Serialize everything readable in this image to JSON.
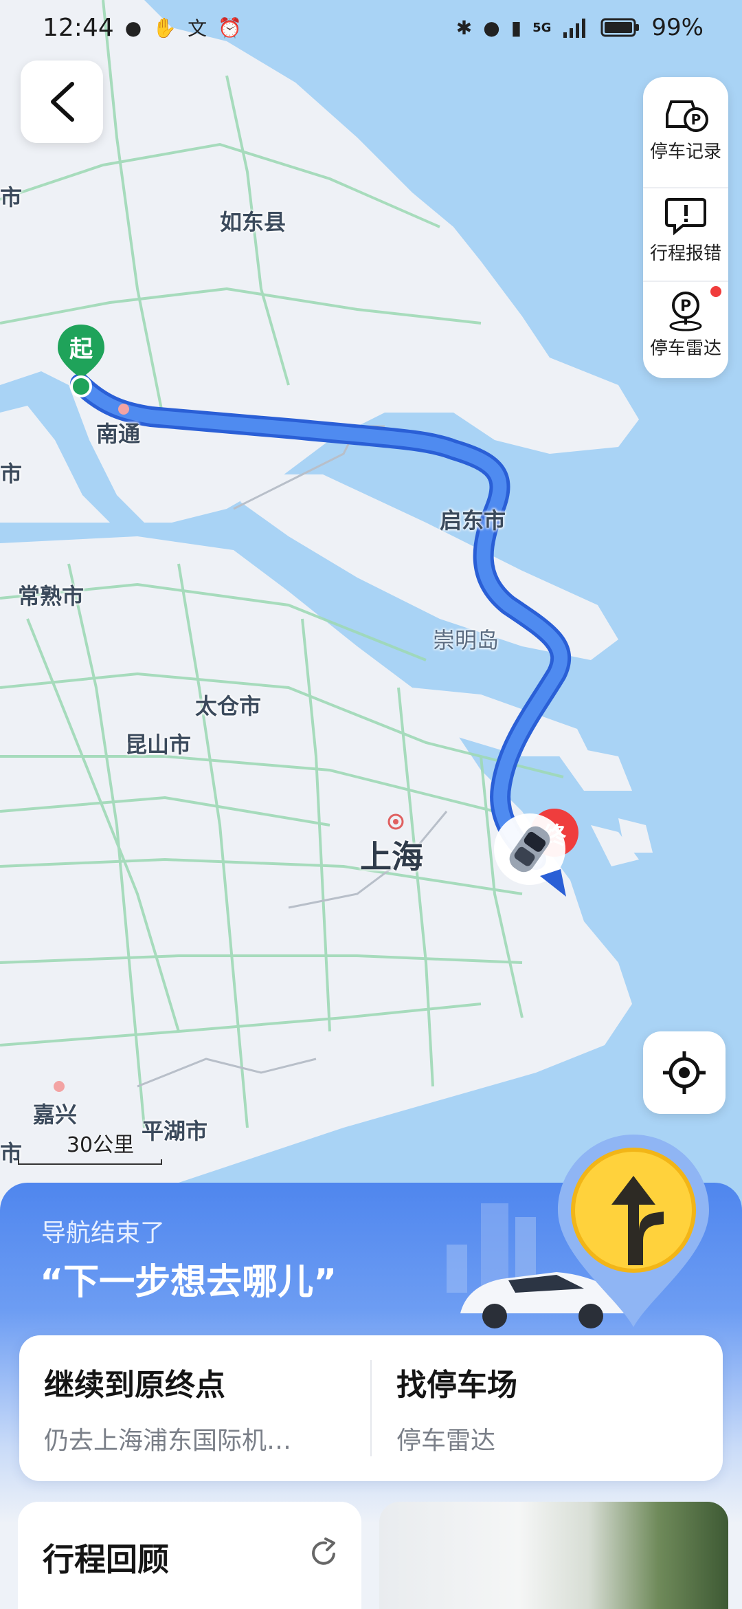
{
  "status_bar": {
    "time": "12:44",
    "battery": "99%",
    "network": "5G",
    "left_icons": [
      "wechat-icon",
      "hand-icon",
      "translate-icon",
      "alarm-icon"
    ],
    "right_icons": [
      "bluetooth-icon",
      "location-icon",
      "vibrate-icon",
      "signal-icon",
      "battery-icon"
    ]
  },
  "map": {
    "places": {
      "rudong": "如东县",
      "nantong": "南通",
      "qidong": "启东市",
      "changshu": "常熟市",
      "chongming": "崇明岛",
      "taicang": "太仓市",
      "kunshan": "昆山市",
      "shanghai": "上海",
      "jiaxing": "嘉兴",
      "pinghu": "平湖市",
      "edge1": "市",
      "edge2": "市",
      "edge3": "市"
    },
    "start_marker": "起",
    "end_marker": "终",
    "scale": "30公里",
    "colors": {
      "water": "#a9d3f5",
      "land": "#eef1f6",
      "route": "#3f7fec",
      "start": "#1fa35a",
      "end": "#ef3d3d"
    }
  },
  "side_panel": {
    "items": [
      {
        "label": "停车记录",
        "icon": "parking-record-icon"
      },
      {
        "label": "行程报错",
        "icon": "report-error-icon"
      },
      {
        "label": "停车雷达",
        "icon": "parking-radar-icon"
      }
    ]
  },
  "sheet": {
    "subtitle": "导航结束了",
    "headline": "“下一步想去哪儿”",
    "choices": [
      {
        "title": "继续到原终点",
        "sub": "仍去上海浦东国际机…"
      },
      {
        "title": "找停车场",
        "sub": "停车雷达"
      }
    ],
    "review": {
      "title": "行程回顾"
    }
  }
}
